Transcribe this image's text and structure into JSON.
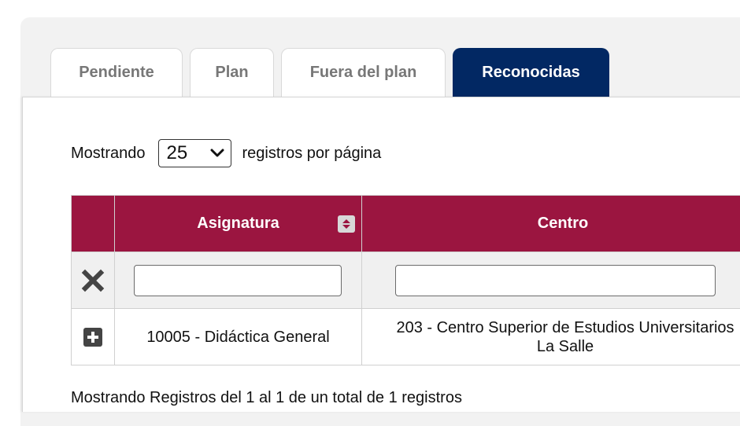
{
  "tabs": [
    {
      "label": "Pendiente",
      "active": false
    },
    {
      "label": "Plan",
      "active": false
    },
    {
      "label": "Fuera del plan",
      "active": false
    },
    {
      "label": "Reconocidas",
      "active": true
    }
  ],
  "length_control": {
    "prefix": "Mostrando",
    "selected_value": "25",
    "suffix": "registros por página"
  },
  "table": {
    "columns": [
      {
        "label": "Asignatura",
        "sort_icon": "sort-both-icon"
      },
      {
        "label": "Centro",
        "sort_icon": "sort-both-icon"
      }
    ],
    "filter_row": {
      "clear_icon": "close-x-icon",
      "asignatura_filter_value": "",
      "centro_filter_value": ""
    },
    "rows": [
      {
        "expand_icon": "plus-square-icon",
        "asignatura": "10005 - Didáctica General",
        "centro_line1": "203 - Centro Superior de Estudios Universitarios",
        "centro_line2": "La Salle"
      }
    ]
  },
  "footer": {
    "info": "Mostrando Registros del 1 al 1 de un total de 1 registros"
  },
  "colors": {
    "active_tab": "#022863",
    "table_header": "#9b1540",
    "panel_background": "#f2f2f2"
  }
}
